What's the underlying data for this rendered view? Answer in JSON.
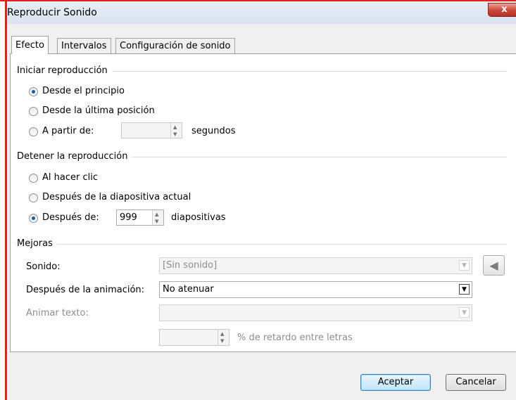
{
  "window": {
    "title": "Reproducir Sonido",
    "close_glyph": "x"
  },
  "tabs": [
    {
      "label": "Efecto",
      "active": true
    },
    {
      "label": "Intervalos",
      "active": false
    },
    {
      "label": "Configuración de sonido",
      "active": false
    }
  ],
  "start_group": {
    "label": "Iniciar reproducción",
    "options": [
      {
        "label": "Desde el principio",
        "checked": true
      },
      {
        "label": "Desde la última posición",
        "checked": false
      },
      {
        "label": "A partir de:",
        "checked": false
      }
    ],
    "start_value": "",
    "start_unit": "segundos"
  },
  "stop_group": {
    "label": "Detener la reproducción",
    "options": [
      {
        "label": "Al hacer clic",
        "checked": false
      },
      {
        "label": "Después de la diapositiva actual",
        "checked": false
      },
      {
        "label": "Después de:",
        "checked": true
      }
    ],
    "after_value": "999",
    "after_unit": "diapositivas"
  },
  "enhancements": {
    "label": "Mejoras",
    "sound_label": "Sonido:",
    "sound_value": "[Sin sonido]",
    "after_anim_label": "Después de la animación:",
    "after_anim_value": "No atenuar",
    "animate_text_label": "Animar texto:",
    "animate_text_value": "",
    "delay_value": "",
    "delay_label": "% de retardo entre letras",
    "speaker_icon": "speaker-icon"
  },
  "buttons": {
    "ok": "Aceptar",
    "cancel": "Cancelar"
  },
  "colors": {
    "accent": "#1d5aa8",
    "border_red": "#e0211c"
  }
}
